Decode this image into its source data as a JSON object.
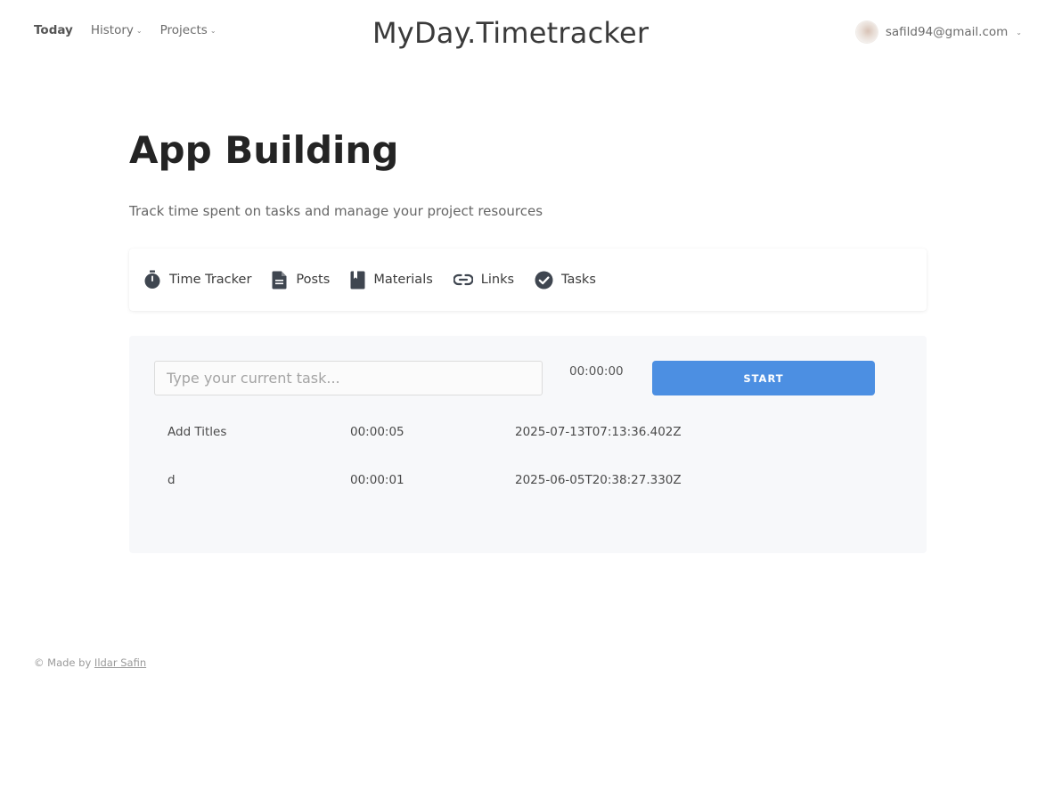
{
  "nav": {
    "items": [
      {
        "label": "Today",
        "active": true,
        "dropdown": false
      },
      {
        "label": "History",
        "active": false,
        "dropdown": true
      },
      {
        "label": "Projects",
        "active": false,
        "dropdown": true
      }
    ],
    "brand": "MyDay.Timetracker",
    "user_email": "safild94@gmail.com"
  },
  "header": {
    "title": "App Building",
    "subtitle": "Track time spent on tasks and manage your project resources"
  },
  "tabs": [
    {
      "label": "Time Tracker",
      "icon": "stopwatch-icon"
    },
    {
      "label": "Posts",
      "icon": "document-icon"
    },
    {
      "label": "Materials",
      "icon": "book-icon"
    },
    {
      "label": "Links",
      "icon": "link-icon"
    },
    {
      "label": "Tasks",
      "icon": "check-circle-icon"
    }
  ],
  "tracker": {
    "input_placeholder": "Type your current task...",
    "input_value": "",
    "timer": "00:00:00",
    "start_label": "START",
    "entries": [
      {
        "task": "Add Titles",
        "duration": "00:00:05",
        "timestamp": "2025-07-13T07:13:36.402Z"
      },
      {
        "task": "d",
        "duration": "00:00:01",
        "timestamp": "2025-06-05T20:38:27.330Z"
      }
    ]
  },
  "footer": {
    "prefix": "© Made by ",
    "author": "Ildar Safin"
  },
  "colors": {
    "accent": "#4c8fe2",
    "panel_bg": "#f7f8fa",
    "icon": "#3f4650"
  }
}
